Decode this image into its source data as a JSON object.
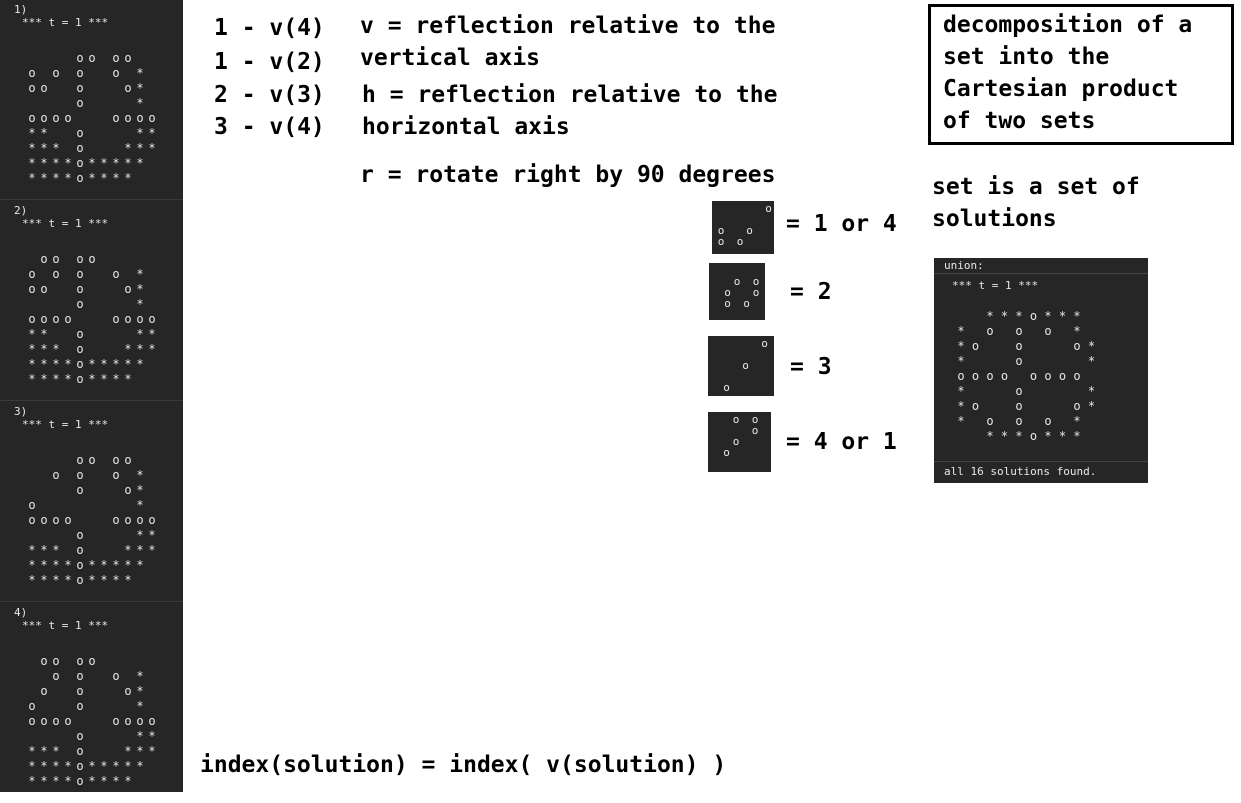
{
  "panels": [
    {
      "num": "1)",
      "header": "*** t = 1 ***",
      "rows": [
        "....oo.oo..",
        "o.o.o..o.*.",
        "oo..o...o*.",
        "....o....*.",
        "oooo...oooo",
        "**..o....**",
        "***.o...***",
        "****o*****.",
        "****o****.."
      ]
    },
    {
      "num": "2)",
      "header": "*** t = 1 ***",
      "rows": [
        ".oo.oo.....",
        "o.o.o..o.*.",
        "oo..o...o*.",
        "....o....*.",
        "oooo...oooo",
        "**..o....**",
        "***.o...***",
        "****o*****.",
        "****o****.."
      ]
    },
    {
      "num": "3)",
      "header": "*** t = 1 ***",
      "rows": [
        "....oo.oo..",
        "..o.o..o.*.",
        "....o...o*.",
        "o........*.",
        "oooo...oooo",
        "....o....**",
        "***.o...***",
        "****o*****.",
        "****o****.."
      ]
    },
    {
      "num": "4)",
      "header": "*** t = 1 ***",
      "rows": [
        ".oo.oo.....",
        "..o.o..o.*.",
        ".o..o...o*.",
        "o...o....*.",
        "oooo...oooo",
        "....o....**",
        "***.o...***",
        "****o*****.",
        "****o****.."
      ]
    }
  ],
  "mapping_lines": [
    "1 - v(4)",
    "1 - v(2)",
    "2 - v(3)",
    "3 - v(4)"
  ],
  "definitions": {
    "v_line1": "v = reflection relative to the",
    "v_line2": "vertical axis",
    "h_line1": "h = reflection relative to the",
    "h_line2": "horizontal axis",
    "r_line": "r = rotate right by 90 degrees"
  },
  "decomposition_box": [
    "decomposition of a",
    "set into the",
    "Cartesian product",
    "of two sets"
  ],
  "set_note": [
    "set is a set of",
    "solutions"
  ],
  "patterns": [
    {
      "label": "= 1 or 4",
      "cells": [
        [
          5,
          0
        ],
        [
          0,
          2
        ],
        [
          3,
          2
        ],
        [
          0,
          3
        ],
        [
          2,
          3
        ]
      ]
    },
    {
      "label": "= 2",
      "cells": [
        [
          2,
          1
        ],
        [
          4,
          1
        ],
        [
          1,
          2
        ],
        [
          4,
          2
        ],
        [
          1,
          3
        ],
        [
          3,
          3
        ]
      ]
    },
    {
      "label": "= 3",
      "cells": [
        [
          5,
          0
        ],
        [
          3,
          2
        ],
        [
          1,
          4
        ]
      ]
    },
    {
      "label": "= 4 or 1",
      "cells": [
        [
          2,
          0
        ],
        [
          4,
          0
        ],
        [
          4,
          1
        ],
        [
          2,
          2
        ],
        [
          1,
          3
        ]
      ]
    }
  ],
  "union": {
    "title": "union:",
    "header": "*** t = 1 ***",
    "rows": [
      "..***o***..",
      "*.o.o.o.*..",
      "*o..o...o*.",
      "*...o....*.",
      "oooo.oooo..",
      "*...o....*.",
      "*o..o...o*.",
      "*.o.o.o.*..",
      "..***o***.."
    ],
    "footer": "all 16 solutions found."
  },
  "formula": "index(solution) = index( v(solution) )"
}
